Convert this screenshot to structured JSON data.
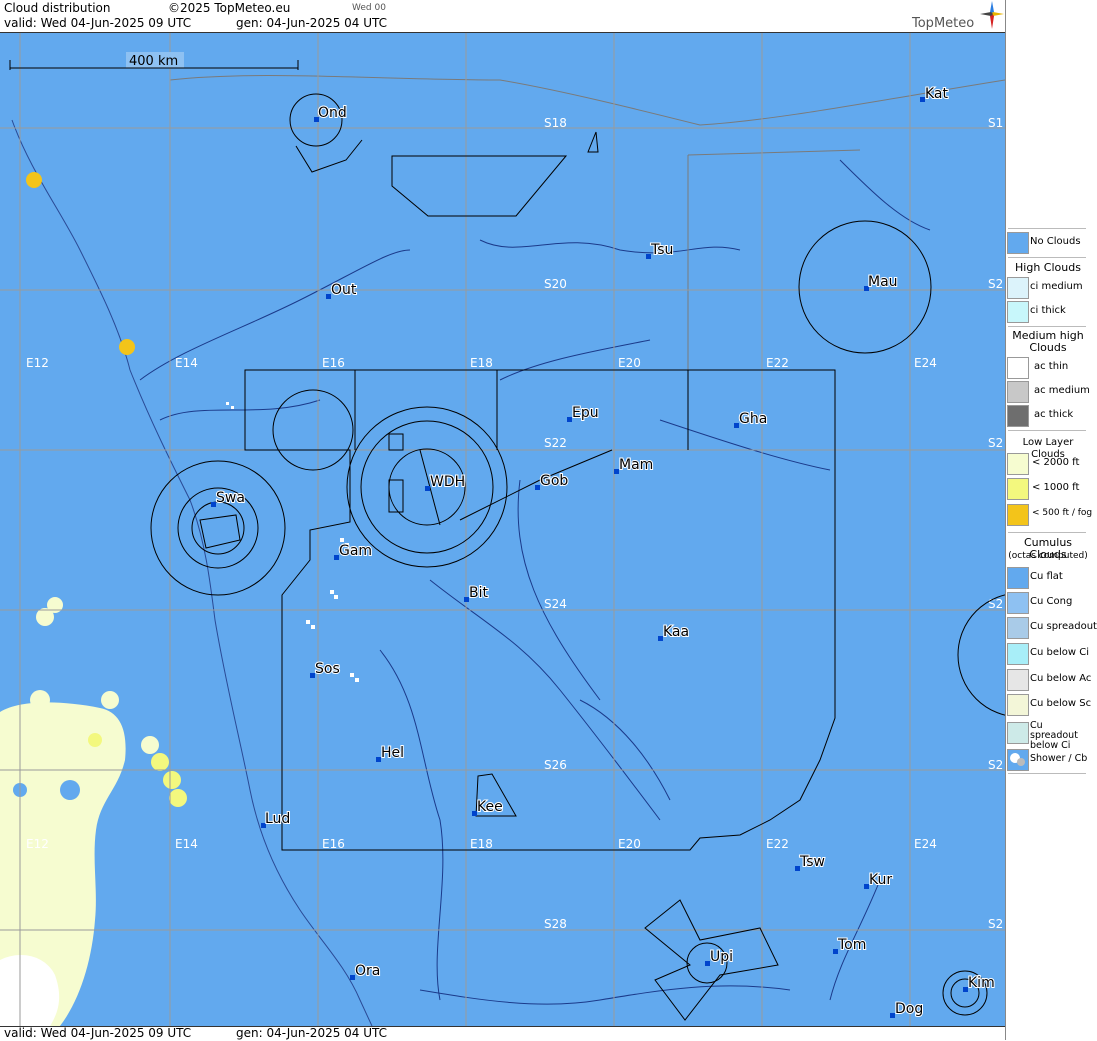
{
  "header": {
    "title": "Cloud distribution",
    "copyright": "©2025 TopMeteo.eu",
    "run_tag": "Wed 00",
    "valid_line": "valid:  Wed  04-Jun-2025  09 UTC",
    "gen_line": "gen: 04-Jun-2025 04 UTC",
    "brand": "TopMeteo"
  },
  "footer": {
    "valid_line": "valid:  Wed  04-Jun-2025  09 UTC",
    "gen_line": "gen: 04-Jun-2025 04 UTC"
  },
  "scale_bar": {
    "label": "400 km"
  },
  "colors": {
    "no_clouds": "#62a9ee",
    "low_cloud_light": "#f6fcd0",
    "low_cloud_medium": "#f3f87e",
    "fog": "#f3c41a",
    "airspace_line": "#000000",
    "river_line": "#1b3a8a"
  },
  "grid": {
    "lon_labels": [
      "E12",
      "E14",
      "E16",
      "E18",
      "E20",
      "E22",
      "E24"
    ],
    "lat_labels": [
      "S18",
      "S20",
      "S22",
      "S24",
      "S26",
      "S28"
    ],
    "lat_edge_label": "S2",
    "lat_edge_label_top": "S1"
  },
  "places": [
    {
      "code": "Ond"
    },
    {
      "code": "Kat"
    },
    {
      "code": "Tsu"
    },
    {
      "code": "Mau"
    },
    {
      "code": "Out"
    },
    {
      "code": "Epu"
    },
    {
      "code": "Gha"
    },
    {
      "code": "Mam"
    },
    {
      "code": "Gob"
    },
    {
      "code": "WDH"
    },
    {
      "code": "Swa"
    },
    {
      "code": "Gam"
    },
    {
      "code": "Bit"
    },
    {
      "code": "Kaa"
    },
    {
      "code": "Sos"
    },
    {
      "code": "Hel"
    },
    {
      "code": "Kee"
    },
    {
      "code": "Lud"
    },
    {
      "code": "Tsw"
    },
    {
      "code": "Kur"
    },
    {
      "code": "Tom"
    },
    {
      "code": "Ora"
    },
    {
      "code": "Upi"
    },
    {
      "code": "Kim"
    },
    {
      "code": "Dog"
    }
  ],
  "legend": {
    "no_clouds": "No Clouds",
    "high_title": "High Clouds",
    "ci_medium": "ci medium",
    "ci_thick": "ci thick",
    "medium_title": "Medium high Clouds",
    "ac_thin": "ac thin",
    "ac_medium": "ac medium",
    "ac_thick": "ac thick",
    "low_title": "Low Layer Clouds",
    "low_2000": "< 2000 ft",
    "low_1000": "< 1000 ft",
    "low_500": "< 500 ft / fog",
    "cu_title": "Cumulus Clouds",
    "cu_subtitle": "(octas computed)",
    "cu_flat": "Cu flat",
    "cu_cong": "Cu Cong",
    "cu_spreadout": "Cu spreadout",
    "cu_below_ci": "Cu below Ci",
    "cu_below_ac": "Cu below Ac",
    "cu_below_sc": "Cu below Sc",
    "cu_spreadout_below_ci": "Cu spreadout below Ci",
    "shower": "Shower / Cb"
  }
}
